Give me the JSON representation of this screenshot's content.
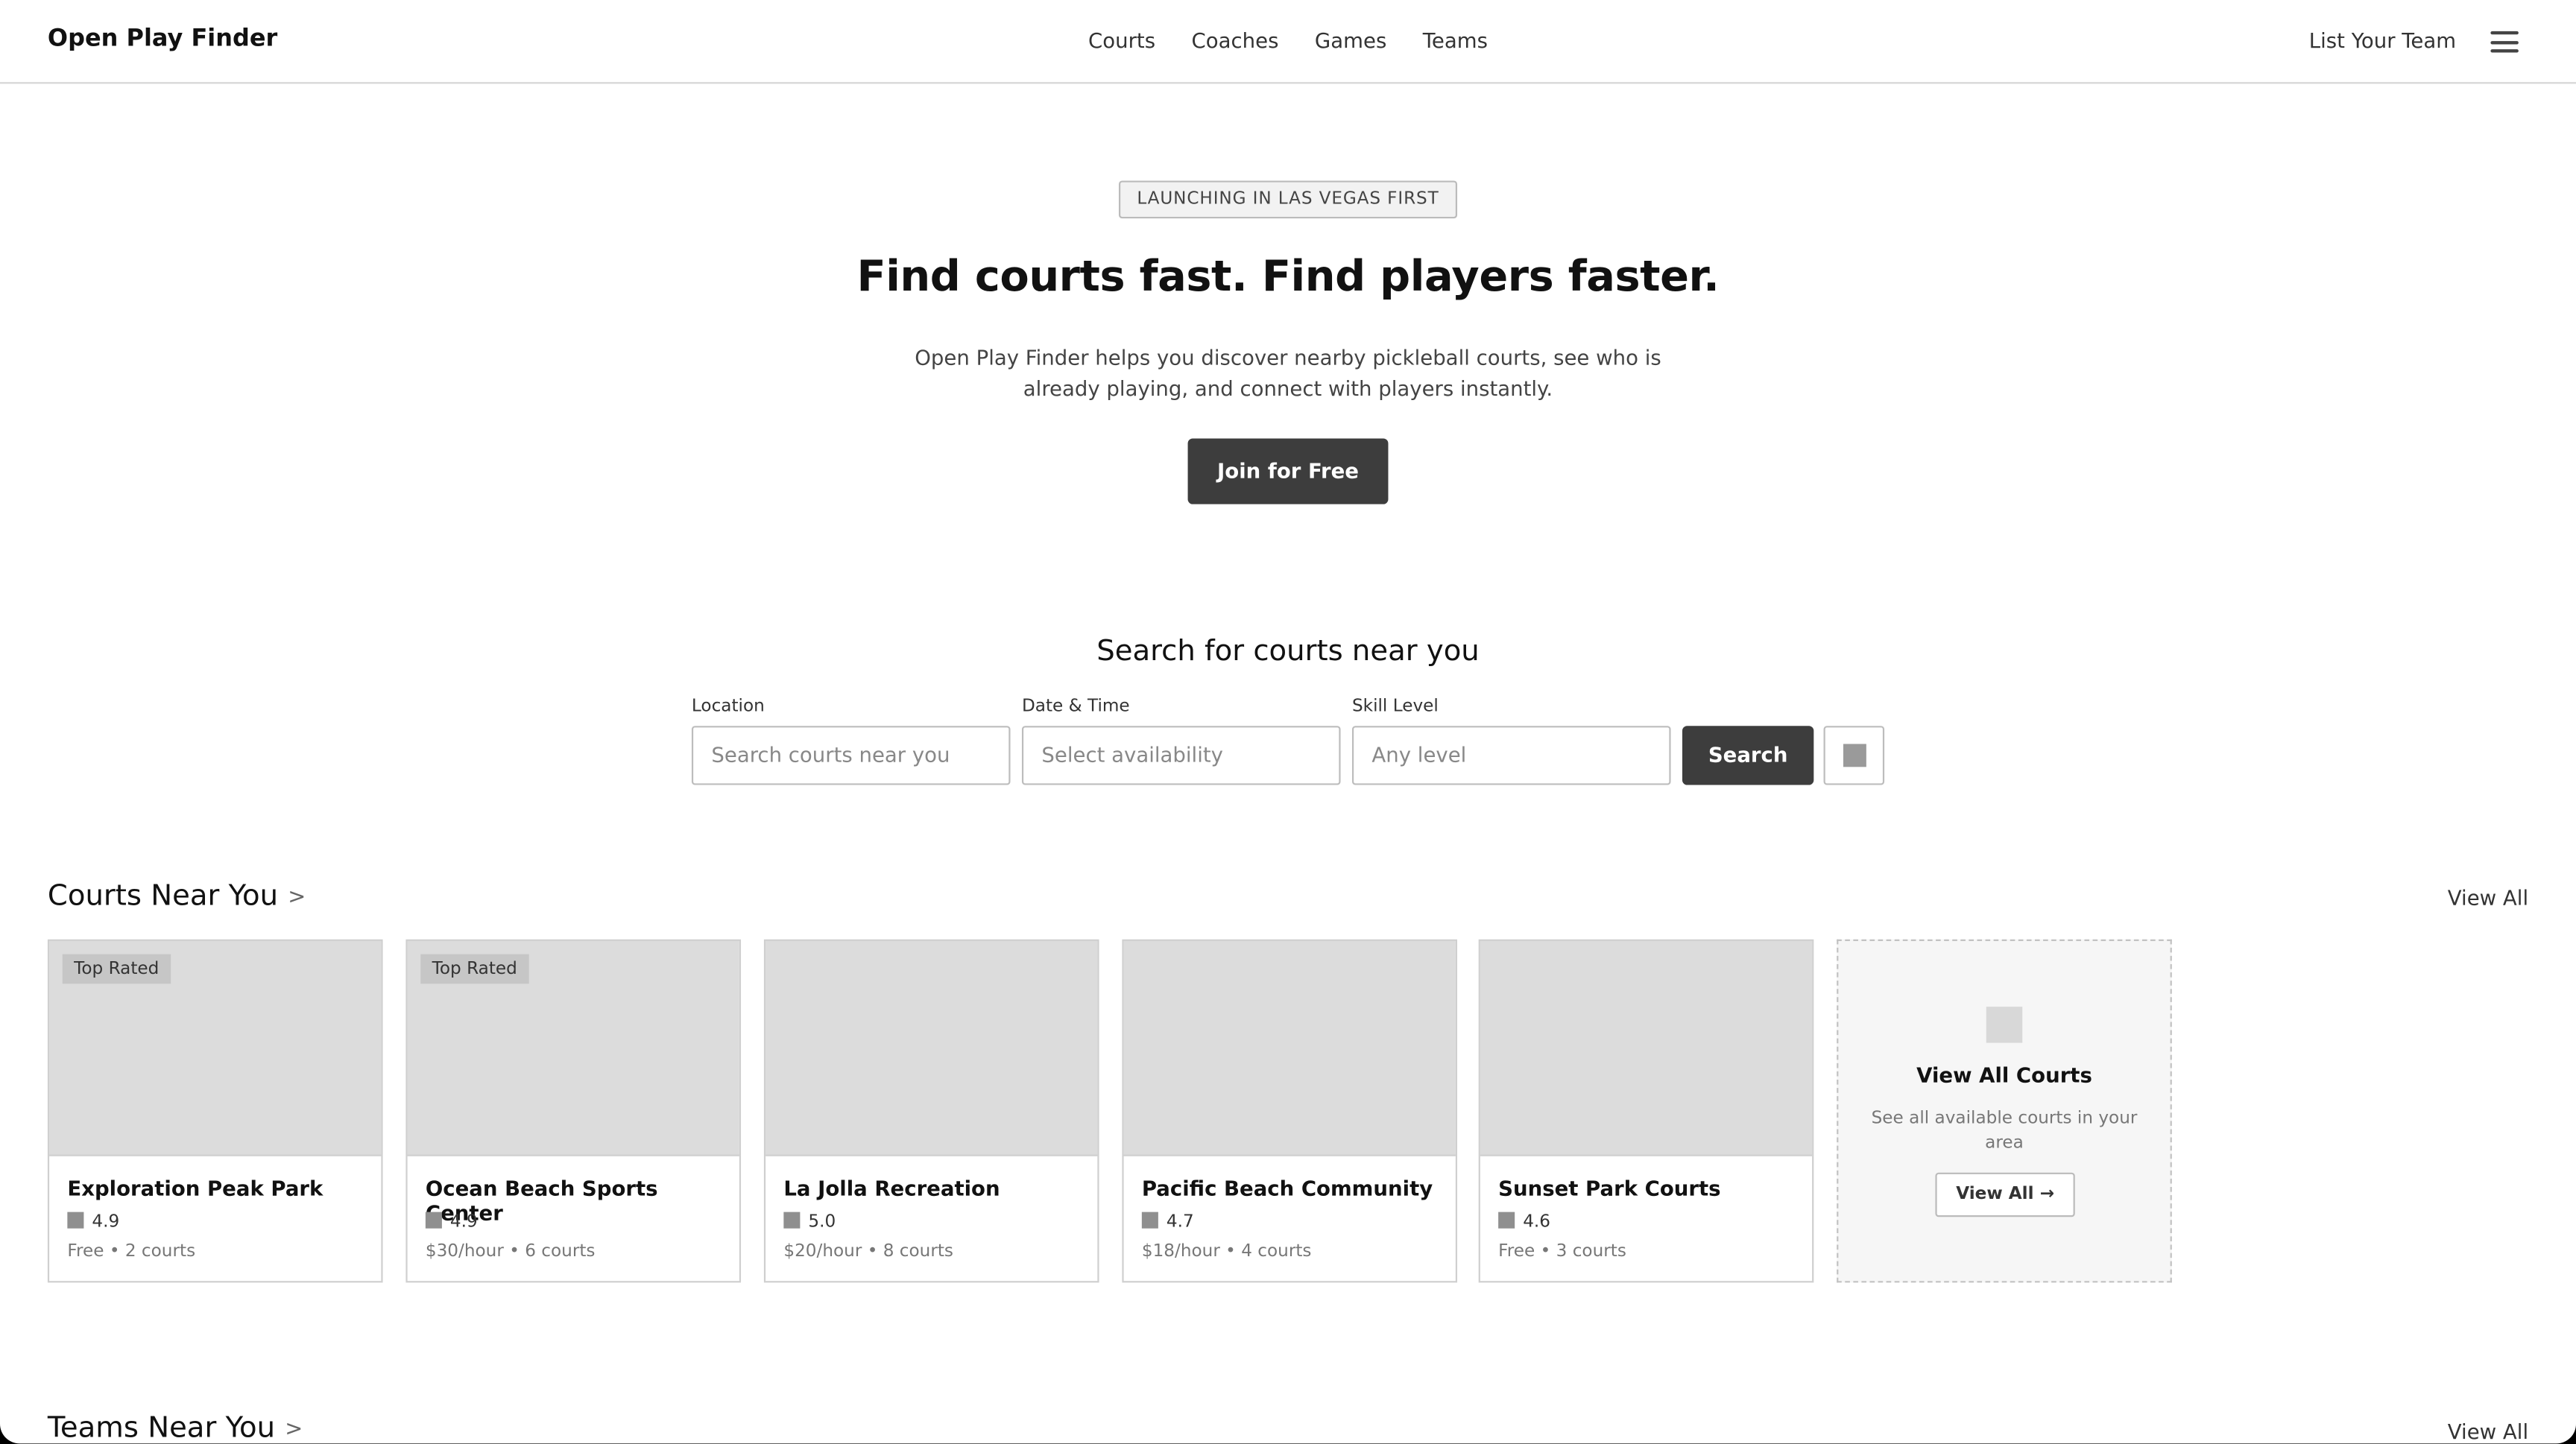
{
  "header": {
    "brand": "Open Play Finder",
    "nav": [
      "Courts",
      "Coaches",
      "Games",
      "Teams"
    ],
    "list_team": "List Your Team"
  },
  "hero": {
    "badge": "LAUNCHING IN LAS VEGAS FIRST",
    "title": "Find courts fast. Find players faster.",
    "subtitle": "Open Play Finder helps you discover nearby pickleball courts, see who is already playing, and connect with players instantly.",
    "cta": "Join for Free"
  },
  "search": {
    "title": "Search for courts near you",
    "location_label": "Location",
    "location_placeholder": "Search courts near you",
    "datetime_label": "Date & Time",
    "datetime_placeholder": "Select availability",
    "skill_label": "Skill Level",
    "skill_placeholder": "Any level",
    "button": "Search"
  },
  "courts": {
    "title": "Courts Near You",
    "chevron": ">",
    "view_all": "View All",
    "items": [
      {
        "tag": "Top Rated",
        "name": "Exploration Peak Park",
        "rating": "4.9",
        "meta": "Free • 2 courts"
      },
      {
        "tag": "Top Rated",
        "name": "Ocean Beach Sports Center",
        "rating": "4.9",
        "meta": "$30/hour • 6 courts"
      },
      {
        "tag": "",
        "name": "La Jolla Recreation",
        "rating": "5.0",
        "meta": "$20/hour • 8 courts"
      },
      {
        "tag": "",
        "name": "Pacific Beach Community",
        "rating": "4.7",
        "meta": "$18/hour • 4 courts"
      },
      {
        "tag": "",
        "name": "Sunset Park Courts",
        "rating": "4.6",
        "meta": "Free • 3 courts"
      }
    ],
    "view_card": {
      "title": "View All Courts",
      "desc": "See all available courts in your area",
      "button": "View All →"
    }
  },
  "teams": {
    "title": "Teams Near You",
    "chevron": ">",
    "view_all": "View All"
  },
  "icons": {
    "menu": "hamburger-menu-icon",
    "search_option": "filter-icon",
    "rating": "star-icon",
    "placeholder": "image-placeholder-icon"
  }
}
